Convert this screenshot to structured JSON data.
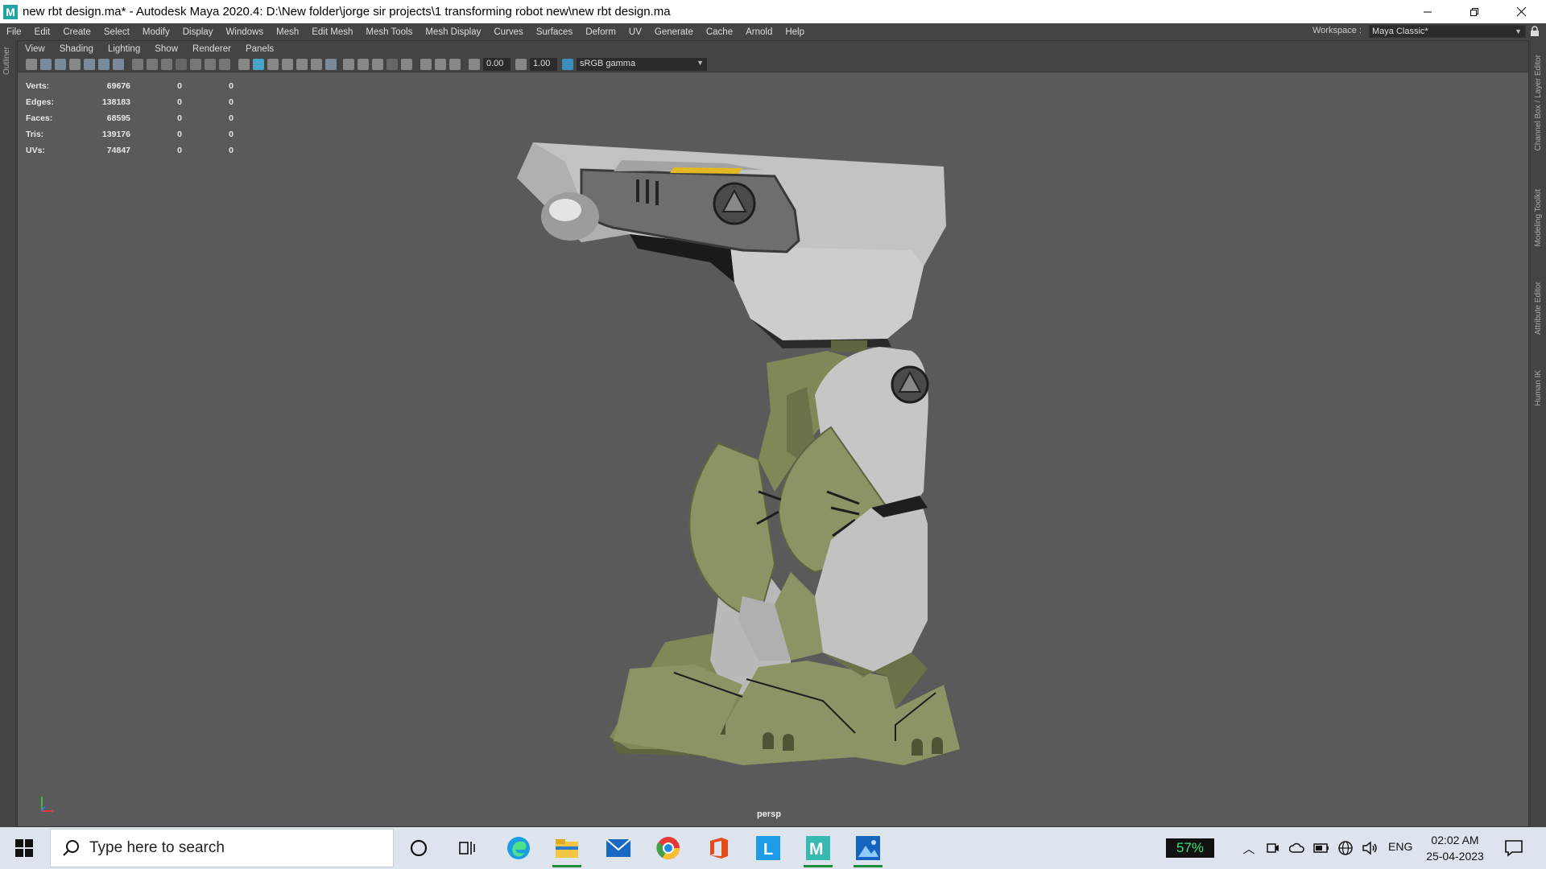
{
  "window": {
    "title": "new rbt design.ma* - Autodesk Maya 2020.4: D:\\New folder\\jorge sir projects\\1 transforming robot new\\new rbt design.ma",
    "app_icon_letter": "M"
  },
  "menubar": {
    "items": [
      "File",
      "Edit",
      "Create",
      "Select",
      "Modify",
      "Display",
      "Windows",
      "Mesh",
      "Edit Mesh",
      "Mesh Tools",
      "Mesh Display",
      "Curves",
      "Surfaces",
      "Deform",
      "UV",
      "Generate",
      "Cache",
      "Arnold",
      "Help"
    ],
    "workspace_label": "Workspace :",
    "workspace_value": "Maya Classic*"
  },
  "left_tabs": [
    "Outliner"
  ],
  "right_tabs": [
    "Channel Box / Layer Editor",
    "Modeling Toolkit",
    "Attribute Editor",
    "Human IK"
  ],
  "panel": {
    "menus": [
      "View",
      "Shading",
      "Lighting",
      "Show",
      "Renderer",
      "Panels"
    ],
    "exposure": "0.00",
    "gamma": "1.00",
    "color_space": "sRGB gamma",
    "camera": "persp"
  },
  "hud": {
    "rows": [
      {
        "label": "Verts:",
        "v1": "69676",
        "v2": "0",
        "v3": "0"
      },
      {
        "label": "Edges:",
        "v1": "138183",
        "v2": "0",
        "v3": "0"
      },
      {
        "label": "Faces:",
        "v1": "68595",
        "v2": "0",
        "v3": "0"
      },
      {
        "label": "Tris:",
        "v1": "139176",
        "v2": "0",
        "v3": "0"
      },
      {
        "label": "UVs:",
        "v1": "74847",
        "v2": "0",
        "v3": "0"
      }
    ]
  },
  "taskbar": {
    "search_placeholder": "Type here to search",
    "apps": [
      "cortana-icon",
      "task-view-icon",
      "edge-icon",
      "file-explorer-icon",
      "mail-icon",
      "chrome-icon",
      "office-icon",
      "l-app-icon",
      "maya-icon",
      "photos-icon"
    ],
    "battery_percent": "57%",
    "language": "ENG",
    "time": "02:02 AM",
    "date": "25-04-2023"
  },
  "colors": {
    "viewport_bg": "#5a5a5a",
    "ui_bg": "#444444",
    "robot_white": "#c8c8c8",
    "robot_green": "#8b9464",
    "accent_yellow": "#e3b822"
  }
}
